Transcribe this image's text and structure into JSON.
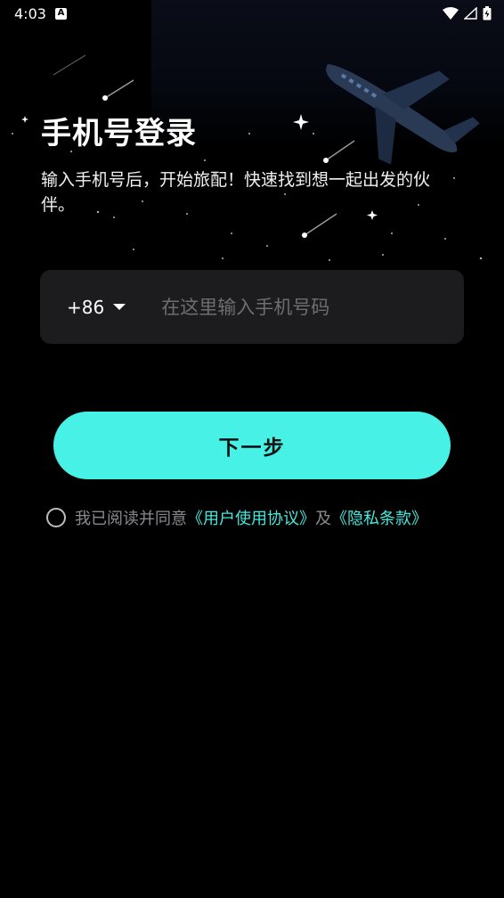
{
  "status_bar": {
    "time": "4:03",
    "notification_badge": "A",
    "icons": [
      "wifi-icon",
      "signal-icon",
      "battery-charging-icon"
    ]
  },
  "login": {
    "title": "手机号登录",
    "subtitle": "输入手机号后，开始旅配！快速找到想一起出发的伙伴。",
    "country_code": "+86",
    "phone_placeholder": "在这里输入手机号码",
    "next_button": "下一步"
  },
  "agreement": {
    "prefix": "我已阅读并同意",
    "user_agreement": "《用户使用协议》",
    "conjunction": "及",
    "privacy_policy": "《隐私条款》"
  },
  "colors": {
    "accent": "#47f1e5",
    "link": "#47e8dc",
    "background": "#000000",
    "input_bg": "#1c1c1e"
  }
}
